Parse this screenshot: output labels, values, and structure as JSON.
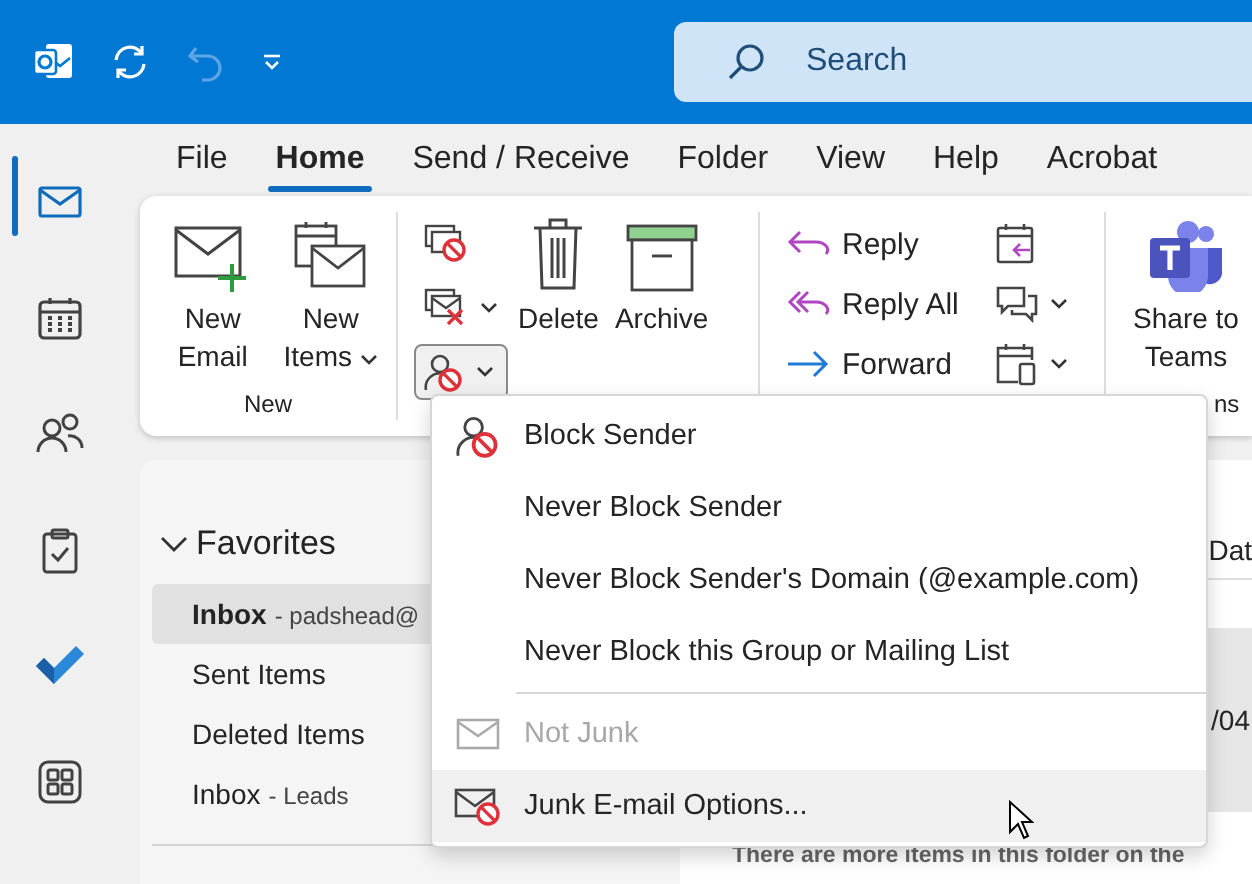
{
  "title_bar": {
    "undo_disabled": true,
    "search": {
      "placeholder": "Search"
    }
  },
  "nav_rail": [
    {
      "kind": "mail",
      "selected": true
    },
    {
      "kind": "calendar",
      "selected": false
    },
    {
      "kind": "people",
      "selected": false
    },
    {
      "kind": "tasks",
      "selected": false
    },
    {
      "kind": "todo",
      "selected": false
    },
    {
      "kind": "apps",
      "selected": false
    }
  ],
  "ribbon_tabs": [
    {
      "label": "File",
      "selected": false
    },
    {
      "label": "Home",
      "selected": true
    },
    {
      "label": "Send / Receive",
      "selected": false
    },
    {
      "label": "Folder",
      "selected": false
    },
    {
      "label": "View",
      "selected": false
    },
    {
      "label": "Help",
      "selected": false
    },
    {
      "label": "Acrobat",
      "selected": false
    }
  ],
  "ribbon": {
    "new_email": "New Email",
    "new_items": "New Items",
    "delete": "Delete",
    "archive": "Archive",
    "reply": "Reply",
    "reply_all": "Reply All",
    "forward": "Forward",
    "share_to_teams": "Share to Teams",
    "junk_open": true,
    "group_labels": [
      "New",
      "ns"
    ]
  },
  "junk_menu": [
    {
      "kind": "item",
      "label": "Block Sender",
      "disabled": false,
      "hovered": false
    },
    {
      "kind": "item",
      "label": "Never Block Sender",
      "disabled": false,
      "hovered": false
    },
    {
      "kind": "item",
      "label": "Never Block Sender's Domain (@example.com)",
      "disabled": false,
      "hovered": false
    },
    {
      "kind": "item",
      "label": "Never Block this Group or Mailing List",
      "disabled": false,
      "hovered": false
    },
    {
      "kind": "separator"
    },
    {
      "kind": "item",
      "label": "Not Junk",
      "disabled": true,
      "hovered": false
    },
    {
      "kind": "item",
      "label": "Junk E-mail Options...",
      "disabled": false,
      "hovered": true
    }
  ],
  "folders": {
    "favorites": {
      "label": "Favorites",
      "expanded": true
    },
    "items": [
      {
        "name": "Inbox",
        "account": "- padshead@",
        "selected": true
      },
      {
        "name": "Sent Items",
        "selected": false
      },
      {
        "name": "Deleted Items",
        "selected": false
      },
      {
        "name": "Inbox",
        "account": "- Leads",
        "selected": false
      }
    ]
  },
  "message_list": {
    "column_header": "Dat",
    "date": "/04",
    "notice": "There are more items in this folder on the"
  }
}
